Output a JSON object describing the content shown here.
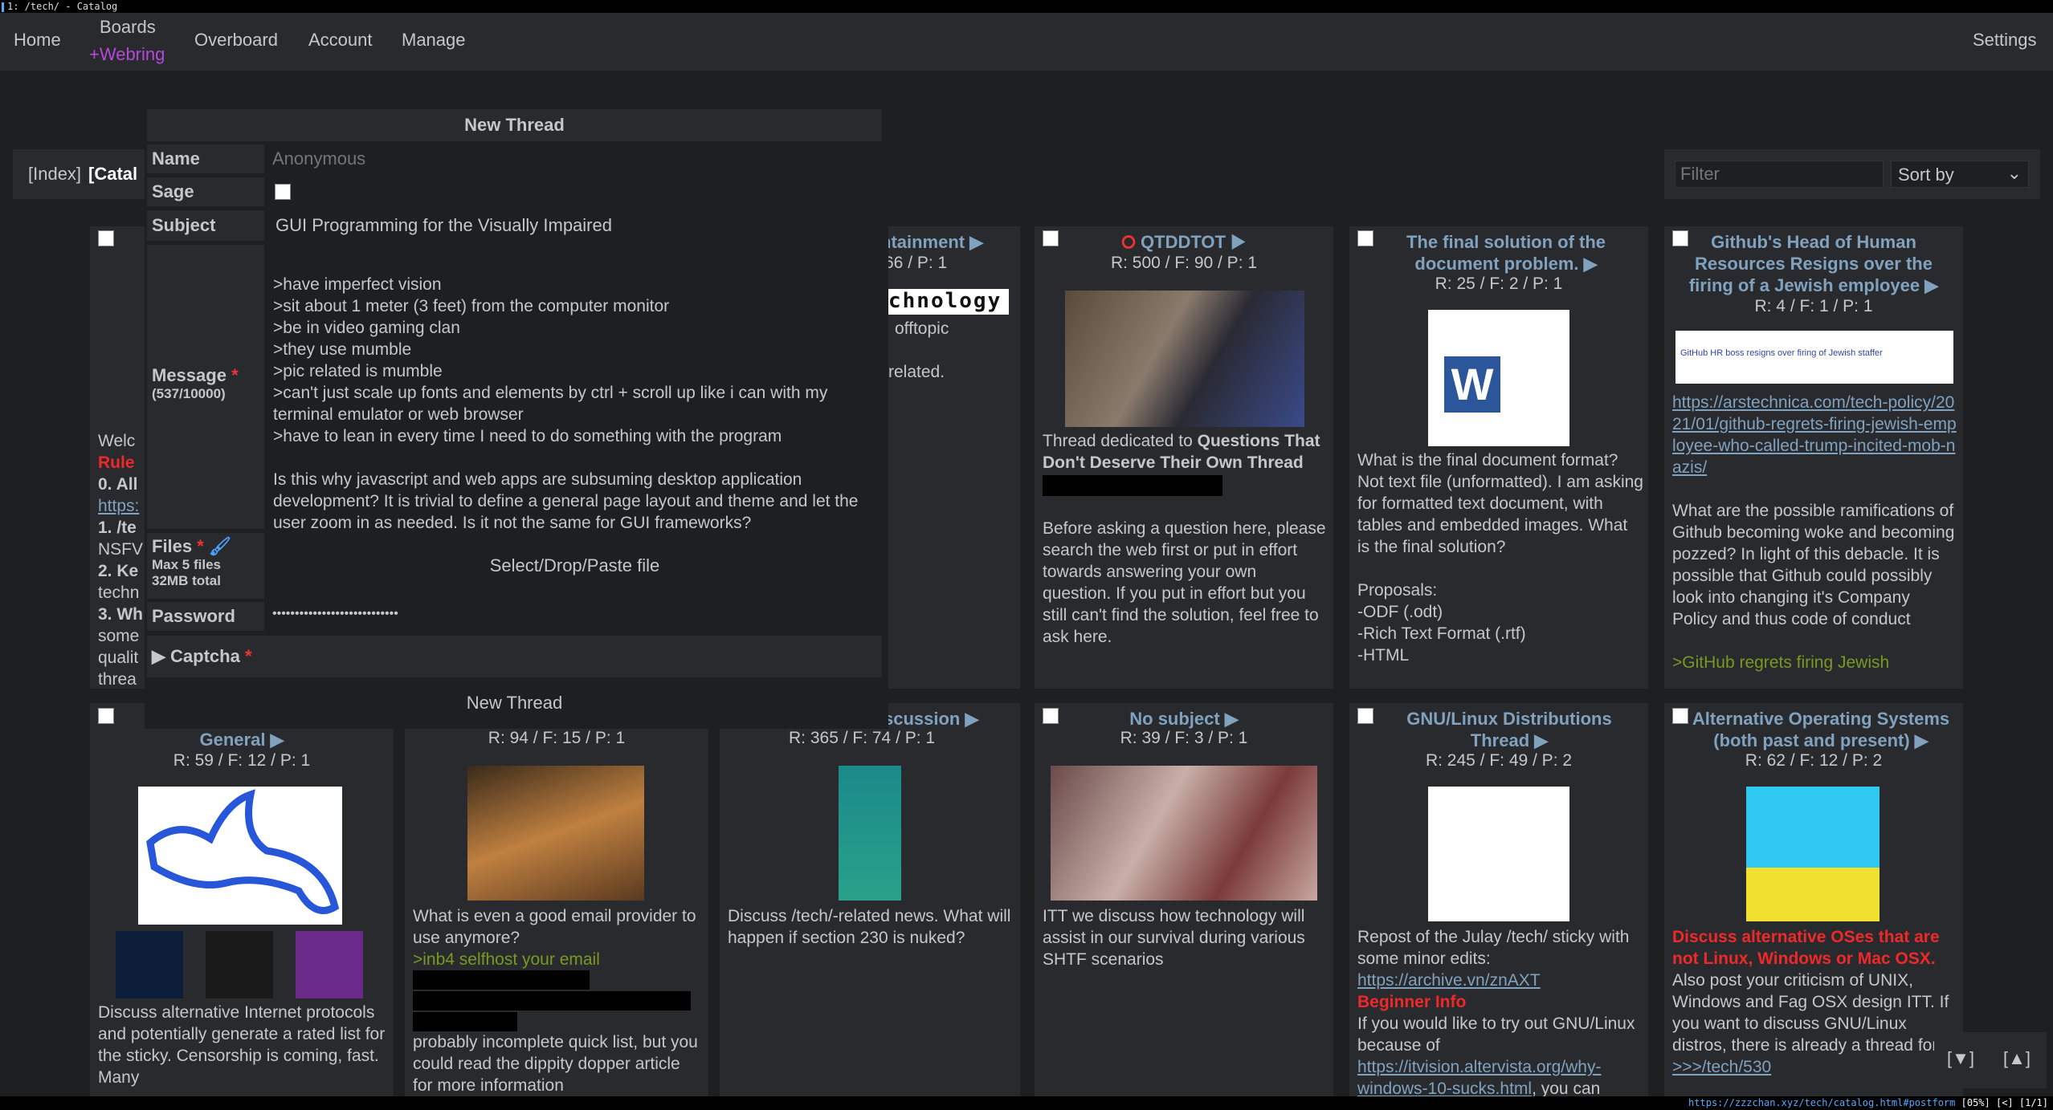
{
  "window": {
    "title": "1: /tech/ - Catalog"
  },
  "nav": {
    "home": "Home",
    "boards": "Boards",
    "webring": "+Webring",
    "overboard": "Overboard",
    "account": "Account",
    "manage": "Manage",
    "settings": "Settings"
  },
  "board_nav": {
    "index": "[Index]",
    "catalog": "[Catal"
  },
  "filter": {
    "placeholder": "Filter",
    "sort_label": "Sort by"
  },
  "form": {
    "header": "New Thread",
    "name_label": "Name",
    "name_placeholder": "Anonymous",
    "sage_label": "Sage",
    "subject_label": "Subject",
    "subject_value": "GUI Programming for the Visually Impaired",
    "message_label": "Message",
    "message_count": "(537/10000)",
    "message_value": ">have imperfect vision\n>sit about 1 meter (3 feet) from the computer monitor\n>be in video gaming clan\n>they use mumble\n>pic related is mumble\n>can't just scale up fonts and elements by ctrl + scroll up like i can with my terminal emulator or web browser\n>have to lean in every time I need to do something with the program\n\nIs this why javascript and web apps are subsuming desktop application development? It is trivial to define a general page layout and theme and let the user zoom in as needed. Is it not the same for GUI frameworks?",
    "files_label": "Files",
    "files_max": "Max 5 files",
    "files_size": "32MB total",
    "files_drop": "Select/Drop/Paste file",
    "password_label": "Password",
    "password_value": "••••••••••••••••••••••••••••",
    "captcha_label": "Captcha",
    "submit": "New Thread",
    "required": "*"
  },
  "cards_row1": [
    {
      "lines": [
        "Welc",
        "Rule",
        "0. All",
        "https:",
        "1. /te",
        "NSFV",
        "2. Ke",
        "techn",
        "3. Wh",
        "some",
        "qualit",
        "threa"
      ]
    },
    {
      "title": "ntainment ▶",
      "stats": "66 / P: 1",
      "thumb_text": "chnology",
      "body1": "offtopic",
      "body2": "related."
    },
    {
      "title": "QTDDTOT ▶",
      "stats": "R: 500 / F: 90 / P: 1",
      "body_a": "Thread dedicated to ",
      "body_b": "Questions That Don't Deserve Their Own Thread",
      "body_c": "Before asking a question here, please search the web first or put in effort towards answering your own question. If you put in effort but you still can't find the solution, feel free to ask here."
    },
    {
      "title": "The final solution of the document problem. ▶",
      "stats": "R: 25 / F: 2 / P: 1",
      "thumb_text": "W",
      "body": "What is the final document format? Not text file (unformatted). I am asking for formatted text document, with tables and embedded images. What is the final solution?\n\nProposals:\n-ODF (.odt)\n-Rich Text Format (.rtf)\n-HTML"
    },
    {
      "title": "Github's Head of Human Resources Resigns over the firing of a Jewish employee ▶",
      "stats": "R: 4 / F: 1 / P: 1",
      "thumb_text": "GitHub HR boss resigns over firing of Jewish staffer",
      "link": "https://arstechnica.com/tech-policy/2021/01/github-regrets-firing-jewish-employee-who-called-trump-incited-mob-nazis/",
      "body": "What are the possible ramifications of Github becoming woke and becoming pozzed? In light of this debacle. It is possible that Github could possibly look into changing it's Company Policy and thus code of conduct",
      "green": ">GitHub regrets firing Jewish"
    }
  ],
  "cards_row2": [
    {
      "title": "General ▶",
      "stats": "R: 59 / F: 12 / P: 1",
      "body": "Discuss alternative Internet protocols and potentially generate a rated list for the sticky. Censorship is coming, fast. Many"
    },
    {
      "stats": "R: 94 / F: 15 / P: 1",
      "body1": "What is even a good email provider to use anymore?",
      "green": ">inb4 selfhost your email",
      "body2": "probably incomplete quick list, but you could read the dippity dopper article for more information"
    },
    {
      "title": "scussion ▶",
      "stats": "R: 365 / F: 74 / P: 1",
      "body": "Discuss /tech/-related news. What will happen if section 230 is nuked?"
    },
    {
      "title": "No subject ▶",
      "stats": "R: 39 / F: 3 / P: 1",
      "body": "ITT we discuss how technology will assist in our survival during various SHTF scenarios"
    },
    {
      "title": "GNU/Linux Distributions Thread ▶",
      "stats": "R: 245 / F: 49 / P: 2",
      "body1": "Repost of the Julay /tech/ sticky with some minor edits:",
      "link1": "https://archive.vn/znAXT",
      "red": "Beginner Info",
      "body2": "If you would like to try out GNU/Linux because of",
      "link2": "https://itvision.altervista.org/why-windows-10-sucks.html",
      "body3": ", you can"
    },
    {
      "title": "Alternative Operating Systems (both past and present) ▶",
      "stats": "R: 62 / F: 12 / P: 2",
      "red": "Discuss alternative OSes that are not Linux, Windows or Mac OSX.",
      "body": "Also post your criticism of UNIX, Windows and Fag OSX design ITT. If you want to discuss GNU/Linux distros, there is already a thread for it: ",
      "link": ">>>/tech/530"
    }
  ],
  "scroll": {
    "down": "[▼]",
    "up": "[▲]"
  },
  "status": {
    "url": "https://zzzchan.xyz/tech/catalog.html#postform",
    "info": "[05%] [<] [1/1]"
  }
}
